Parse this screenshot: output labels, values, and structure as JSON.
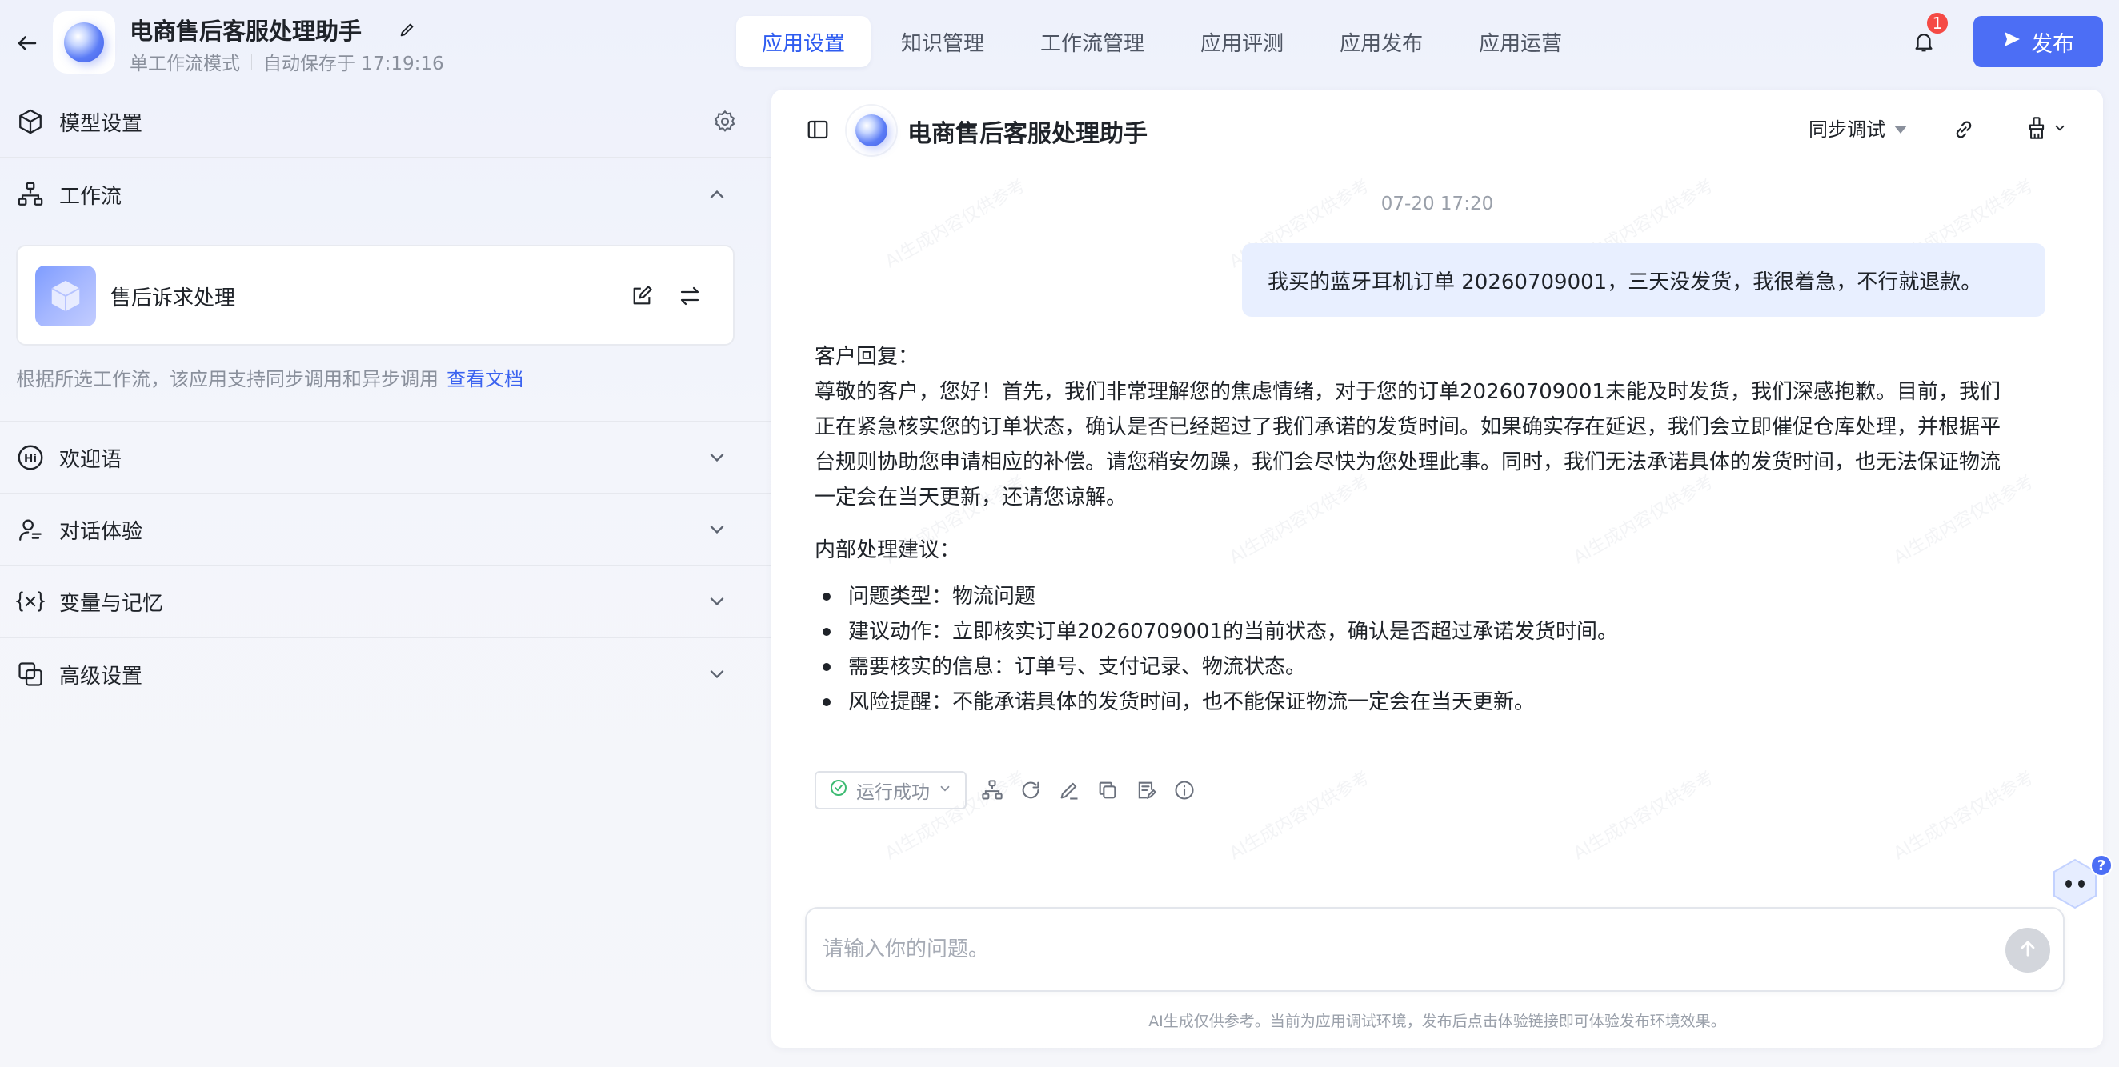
{
  "header": {
    "app_title": "电商售后客服处理助手",
    "mode_label": "单工作流模式",
    "autosave_label": "自动保存于 17:19:16",
    "tabs": [
      {
        "label": "应用设置",
        "active": true
      },
      {
        "label": "知识管理",
        "active": false
      },
      {
        "label": "工作流管理",
        "active": false
      },
      {
        "label": "应用评测",
        "active": false
      },
      {
        "label": "应用发布",
        "active": false
      },
      {
        "label": "应用运营",
        "active": false
      }
    ],
    "notification_count": "1",
    "publish_label": "发布"
  },
  "sidebar": {
    "model_settings": "模型设置",
    "workflow_section": "工作流",
    "workflow_card_name": "售后诉求处理",
    "workflow_hint": "根据所选工作流，该应用支持同步调用和异步调用",
    "workflow_doc_link": "查看文档",
    "welcome": "欢迎语",
    "conversation": "对话体验",
    "variables": "变量与记忆",
    "advanced": "高级设置"
  },
  "chat": {
    "title": "电商售后客服处理助手",
    "debug_mode": "同步调试",
    "timestamp": "07-20 17:20",
    "user_message": "我买的蓝牙耳机订单 20260709001，三天没发货，我很着急，不行就退款。",
    "bot_reply_heading": "客户回复：",
    "bot_reply_body": "尊敬的客户，您好！首先，我们非常理解您的焦虑情绪，对于您的订单20260709001未能及时发货，我们深感抱歉。目前，我们正在紧急核实您的订单状态，确认是否已经超过了我们承诺的发货时间。如果确实存在延迟，我们会立即催促仓库处理，并根据平台规则协助您申请相应的补偿。请您稍安勿躁，我们会尽快为您处理此事。同时，我们无法承诺具体的发货时间，也无法保证物流一定会在当天更新，还请您谅解。",
    "internal_heading": "内部处理建议：",
    "internal_items": [
      "问题类型：物流问题",
      "建议动作：立即核实订单20260709001的当前状态，确认是否超过承诺发货时间。",
      "需要核实的信息：订单号、支付记录、物流状态。",
      "风险提醒：不能承诺具体的发货时间，也不能保证物流一定会在当天更新。"
    ],
    "run_status": "运行成功",
    "input_placeholder": "请输入你的问题。",
    "input_value": "",
    "footer_note": "AI生成仅供参考。当前为应用调试环境，发布后点击体验链接即可体验发布环境效果。",
    "watermark_text": "AI生成内容仅供参考",
    "help_badge": "?"
  },
  "colors": {
    "accent": "#4c6ef5",
    "active_tab_text": "#2f5cf0",
    "user_bubble": "#e8efff",
    "badge_red": "#f54a45",
    "success_green": "#3dbb72"
  }
}
